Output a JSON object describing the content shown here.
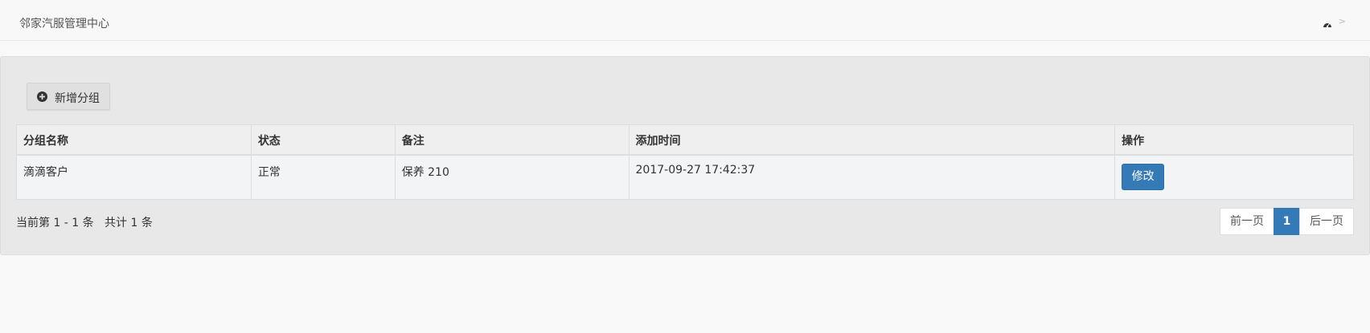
{
  "navbar": {
    "brand": "邻家汽服管理中心",
    "breadcrumb_sep": ">"
  },
  "toolbar": {
    "add_label": "新增分组"
  },
  "table": {
    "headers": [
      "分组名称",
      "状态",
      "备注",
      "添加时间",
      "操作"
    ],
    "rows": [
      {
        "name": "滴滴客户",
        "status": "正常",
        "remark": "保养 210",
        "added_at": "2017-09-27 17:42:37",
        "action": "修改"
      }
    ]
  },
  "footer": {
    "summary": "当前第 1 - 1 条   共计 1 条"
  },
  "pagination": {
    "prev": "前一页",
    "current": "1",
    "next": "后一页"
  },
  "colors": {
    "primary": "#337ab7",
    "panel_bg": "#e8e8e8"
  },
  "icons": {
    "add": "plus-circle-icon",
    "dashboard": "dashboard-icon"
  }
}
